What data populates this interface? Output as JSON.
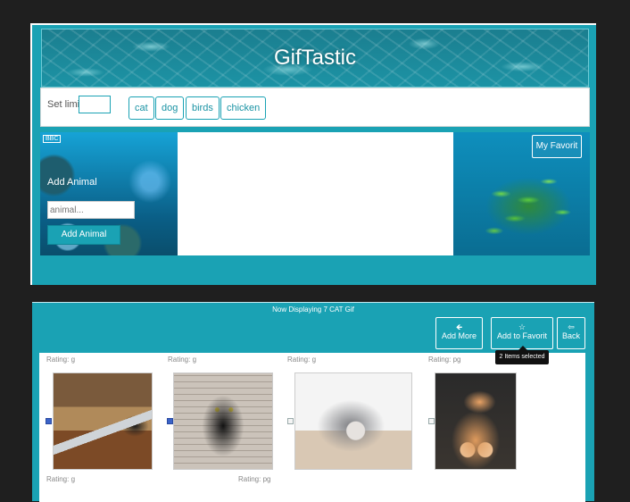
{
  "header": {
    "title": "GifTastic"
  },
  "toolbar": {
    "limit_label": "Set limit",
    "limit_value": "",
    "topics": [
      "cat",
      "dog",
      "birds",
      "chicken"
    ]
  },
  "add_panel": {
    "bbc": "BBC",
    "label": "Add Animal",
    "input_placeholder": "animal...",
    "button": "Add Animal"
  },
  "favorite_panel": {
    "button": "My Favorit"
  },
  "results": {
    "title": "Now Displaying 7 CAT Gif",
    "actions": {
      "add_more": {
        "icon": "🡸",
        "label": "Add More"
      },
      "add_to_favorite": {
        "icon": "☆",
        "label": "Add to Favorit"
      },
      "back": {
        "icon": "⇦",
        "label": "Back"
      }
    },
    "tooltip": "2 Items selected",
    "gifs": [
      {
        "rating": "Rating: g",
        "checked": true,
        "image": "cat-with-laptop"
      },
      {
        "rating": "Rating: g",
        "checked": true,
        "image": "black-cat-sitting"
      },
      {
        "rating": "Rating: g",
        "checked": false,
        "image": "tabby-cat-crouching"
      },
      {
        "rating": "Rating: pg",
        "checked": false,
        "image": "orange-cat-paws-up"
      }
    ],
    "bottom_ratings": [
      "Rating: g",
      "Rating: pg"
    ]
  },
  "colors": {
    "accent": "#1aa2b4",
    "background": "#1f1f1f",
    "checkbox_checked": "#3b63c8"
  }
}
